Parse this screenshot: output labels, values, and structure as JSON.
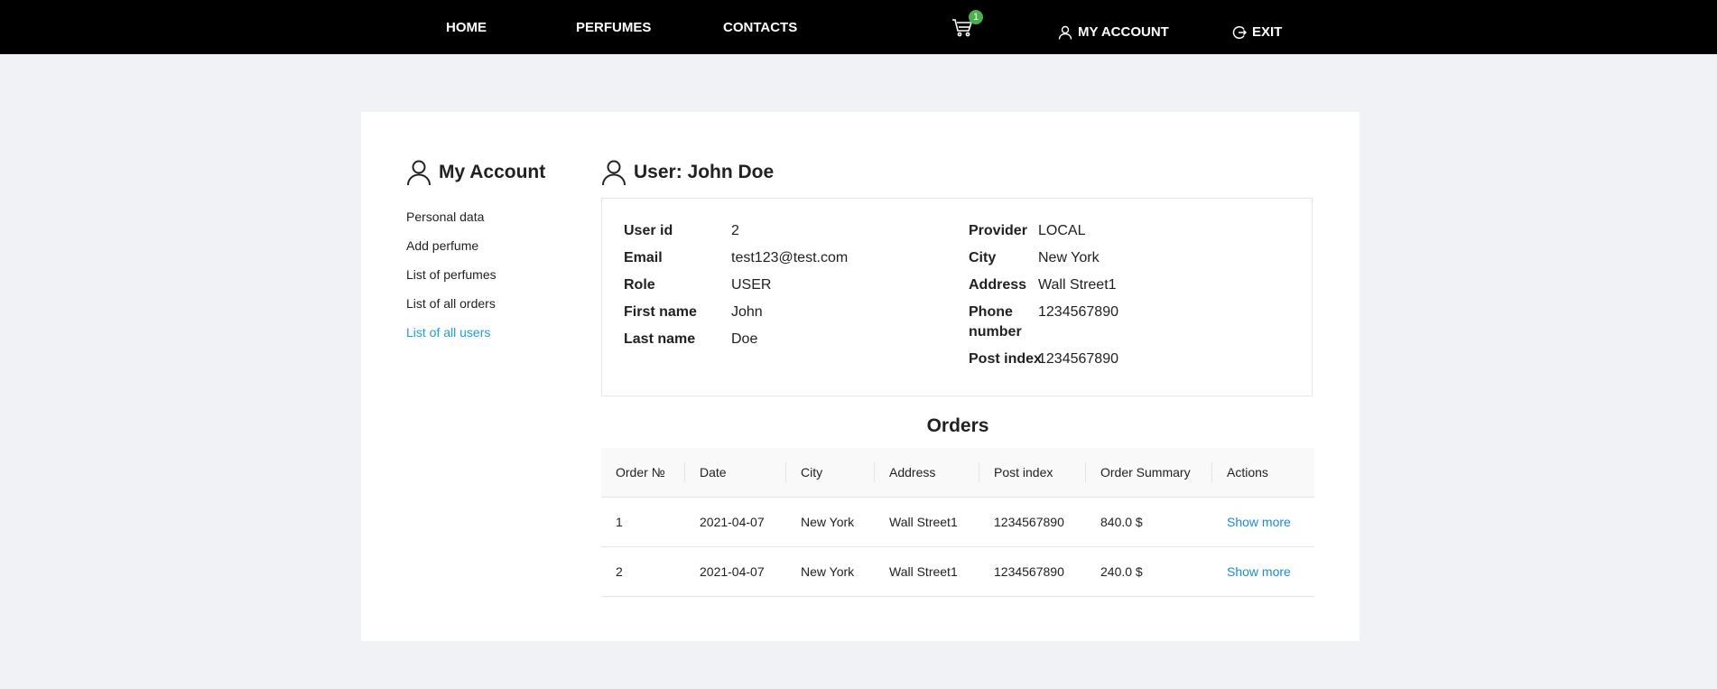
{
  "nav": {
    "home": "HOME",
    "perfumes": "PERFUMES",
    "contacts": "CONTACTS",
    "cart_count": "1",
    "my_account": "MY ACCOUNT",
    "exit": "EXIT"
  },
  "sidebar": {
    "title": "My Account",
    "items": [
      {
        "label": "Personal data"
      },
      {
        "label": "Add perfume"
      },
      {
        "label": "List of perfumes"
      },
      {
        "label": "List of all orders"
      },
      {
        "label": "List of all users"
      }
    ]
  },
  "user": {
    "title": "User: John Doe",
    "left": [
      {
        "label": "User id",
        "value": "2"
      },
      {
        "label": "Email",
        "value": "test123@test.com"
      },
      {
        "label": "Role",
        "value": "USER"
      },
      {
        "label": "First name",
        "value": "John"
      },
      {
        "label": "Last name",
        "value": "Doe"
      }
    ],
    "right": [
      {
        "label": "Provider",
        "value": "LOCAL"
      },
      {
        "label": "City",
        "value": "New York"
      },
      {
        "label": "Address",
        "value": "Wall Street1"
      },
      {
        "label_line1": "Phone",
        "label_line2": "number",
        "value": "1234567890"
      },
      {
        "label": "Post index",
        "value": "1234567890"
      }
    ]
  },
  "orders": {
    "title": "Orders",
    "columns": [
      "Order №",
      "Date",
      "City",
      "Address",
      "Post index",
      "Order Summary",
      "Actions"
    ],
    "rows": [
      {
        "id": "1",
        "date": "2021-04-07",
        "city": "New York",
        "address": "Wall Street1",
        "post_index": "1234567890",
        "summary": "840.0 $",
        "action": "Show more"
      },
      {
        "id": "2",
        "date": "2021-04-07",
        "city": "New York",
        "address": "Wall Street1",
        "post_index": "1234567890",
        "summary": "240.0 $",
        "action": "Show more"
      }
    ]
  },
  "colors": {
    "nav_bg": "#000000",
    "page_bg": "#f0f2f5",
    "active_link": "#1a9fd6",
    "action_link": "#1a8bd6",
    "badge": "#4caf50"
  }
}
